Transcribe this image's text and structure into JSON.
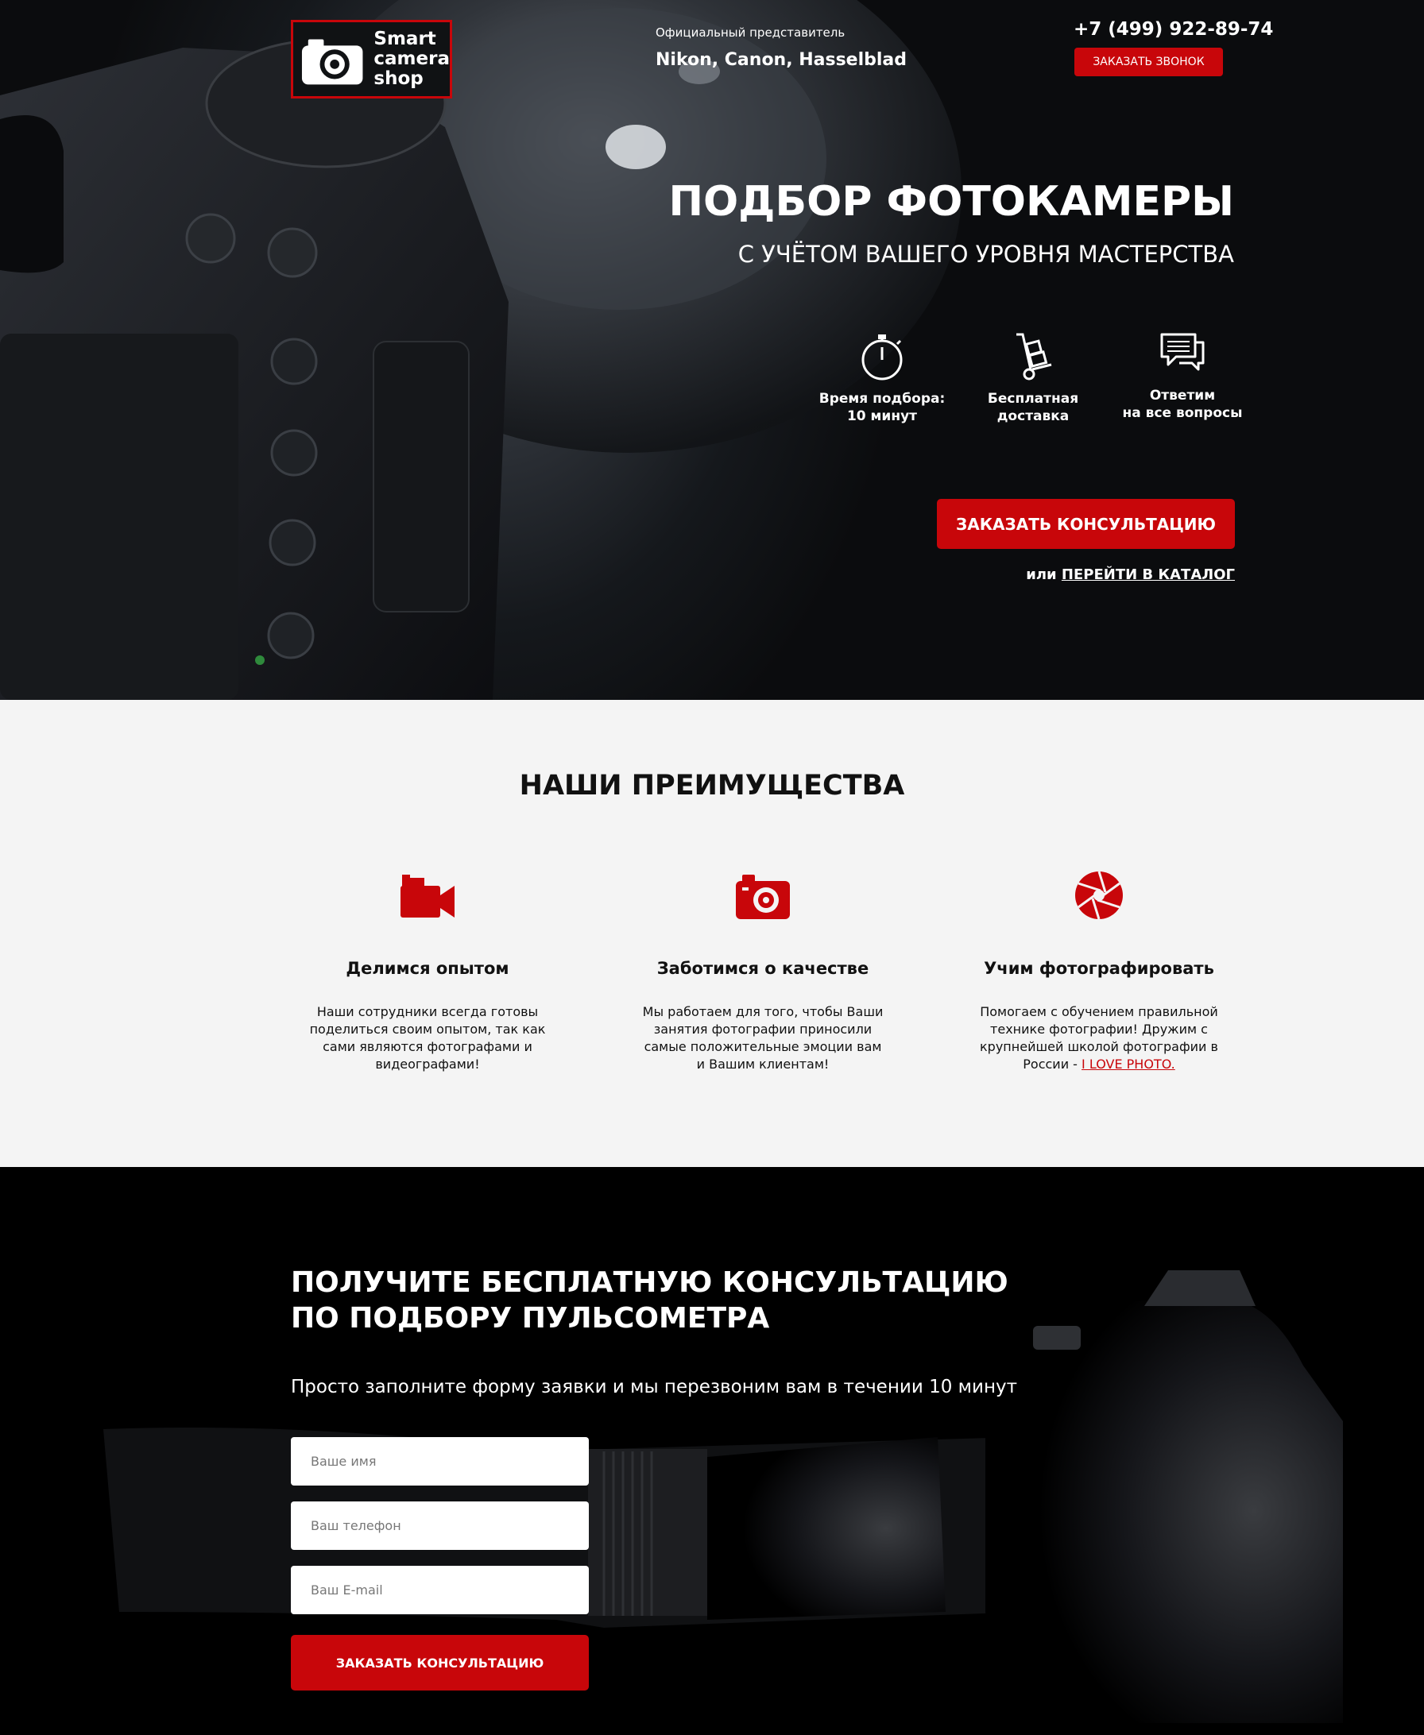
{
  "header": {
    "logo_text": [
      "Smart",
      "camera",
      "shop"
    ],
    "rep_label": "Официальный представитель",
    "rep_brands": "Nikon, Canon, Hasselblad",
    "phone": "+7 (499) 922-89-74",
    "call_button": "ЗАКАЗАТЬ ЗВОНОК"
  },
  "hero": {
    "title": "ПОДБОР ФОТОКАМЕРЫ",
    "subtitle": "С УЧЁТОМ ВАШЕГО УРОВНЯ МАСТЕРСТВА",
    "features": [
      {
        "icon": "stopwatch-icon",
        "line1": "Время подбора:",
        "line2": "10 минут"
      },
      {
        "icon": "hand-truck-icon",
        "line1": "Бесплатная",
        "line2": "доставка"
      },
      {
        "icon": "chat-bubbles-icon",
        "line1": "Ответим",
        "line2": "на все вопросы"
      }
    ],
    "consult_button": "ЗАКАЗАТЬ КОНСУЛЬТАЦИЮ",
    "or_text": "или",
    "catalog_link": "ПЕРЕЙТИ В КАТАЛОГ"
  },
  "advantages": {
    "title": "НАШИ ПРЕИМУЩЕСТВА",
    "items": [
      {
        "icon": "video-camera-icon",
        "heading": "Делимся опытом",
        "lines": [
          "Наши сотрудники всегда готовы",
          "поделиться своим опытом, так как",
          "сами являются фотографами и",
          "видеографами!"
        ]
      },
      {
        "icon": "photo-camera-icon",
        "heading": "Заботимся о качестве",
        "lines": [
          "Мы работаем для того, чтобы Ваши",
          "занятия фотографии приносили",
          "самые положительные эмоции вам",
          "и Вашим клиентам!"
        ]
      },
      {
        "icon": "aperture-icon",
        "heading": "Учим фотографировать",
        "lines": [
          "Помогаем с обучением правильной",
          "технике фотографии! Дружим с",
          "крупнейшей школой фотографии в"
        ],
        "last_prefix": "России - ",
        "link": "I LOVE PHOTO."
      }
    ]
  },
  "form": {
    "title_line1": "ПОЛУЧИТЕ БЕСПЛАТНУЮ КОНСУЛЬТАЦИЮ",
    "title_line2": "ПО ПОДБОРУ ПУЛЬСОМЕТРА",
    "subtitle": "Просто заполните форму заявки и мы перезвоним вам в течении 10 минут",
    "name_placeholder": "Ваше имя",
    "phone_placeholder": "Ваш телефон",
    "email_placeholder": "Ваш E-mail",
    "submit": "ЗАКАЗАТЬ КОНСУЛЬТАЦИЮ"
  },
  "colors": {
    "accent": "#c8060a",
    "dark": "#0b0c0e",
    "light_bg": "#f4f4f4"
  }
}
